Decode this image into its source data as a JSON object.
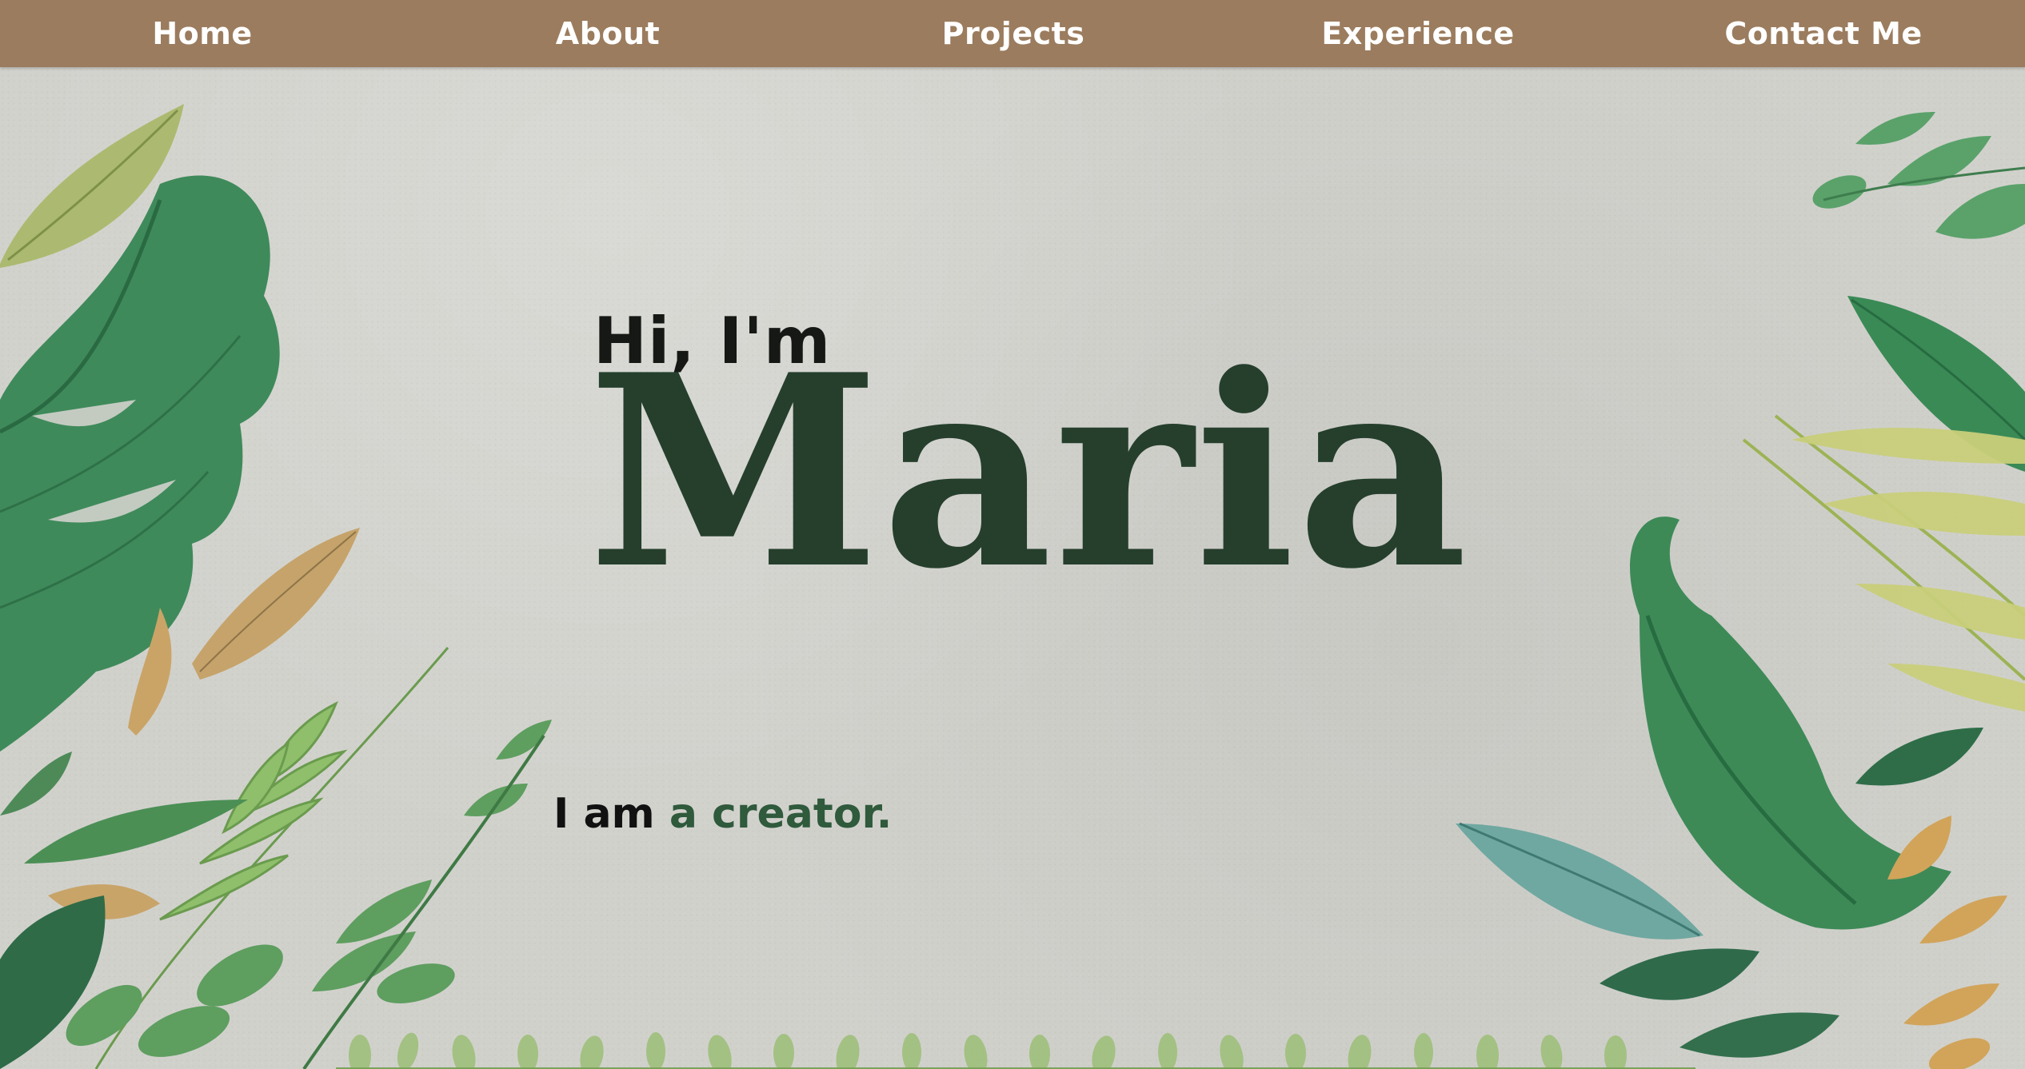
{
  "nav": {
    "items": [
      {
        "label": "Home"
      },
      {
        "label": "About"
      },
      {
        "label": "Projects"
      },
      {
        "label": "Experience"
      },
      {
        "label": "Contact Me"
      }
    ]
  },
  "hero": {
    "greeting": "Hi, I'm",
    "name": "Maria",
    "tagline_prefix": "I am",
    "tagline_highlight": "a creator."
  },
  "colors": {
    "nav_bg": "#9b7c5e",
    "page_bg": "#d1d1cc",
    "name_color": "#253f2c",
    "highlight_color": "#2f5a3c"
  }
}
